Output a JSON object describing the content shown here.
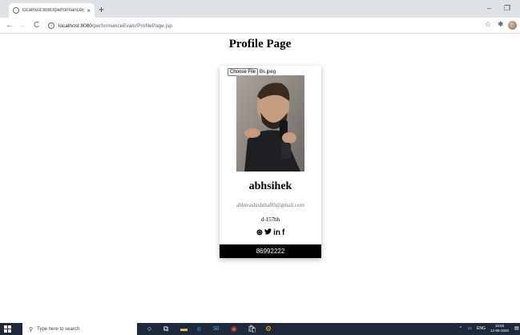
{
  "browser": {
    "tab_title": "localhost:8080/performanceEval",
    "tab_close": "×",
    "new_tab": "+",
    "minimize": "–",
    "restore": "❐",
    "back": "←",
    "forward": "→",
    "reload": "C",
    "url_host": "localhost:8080",
    "url_path": "/performanceEvalu/ProfilePage.jsp",
    "star": "☆",
    "extensions": "✱"
  },
  "page": {
    "title": "Profile Page",
    "file_button": "Choose File",
    "file_name": "Bs.jpeg",
    "name": "abhsihek",
    "email": "abhivashishtha00@gmail.com",
    "id": "d-157bh",
    "socials": [
      "dribbble-icon",
      "twitter-icon",
      "linkedin-icon",
      "facebook-icon"
    ],
    "social_glyphs": [
      "⊛",
      "🐦",
      "in",
      "f"
    ],
    "phone": "86992222"
  },
  "taskbar": {
    "search_placeholder": "Type here to search",
    "search_glyph": "⚲",
    "tray_up": "^",
    "lang": "ENG",
    "time": "15:50",
    "date": "12-08-2020"
  }
}
